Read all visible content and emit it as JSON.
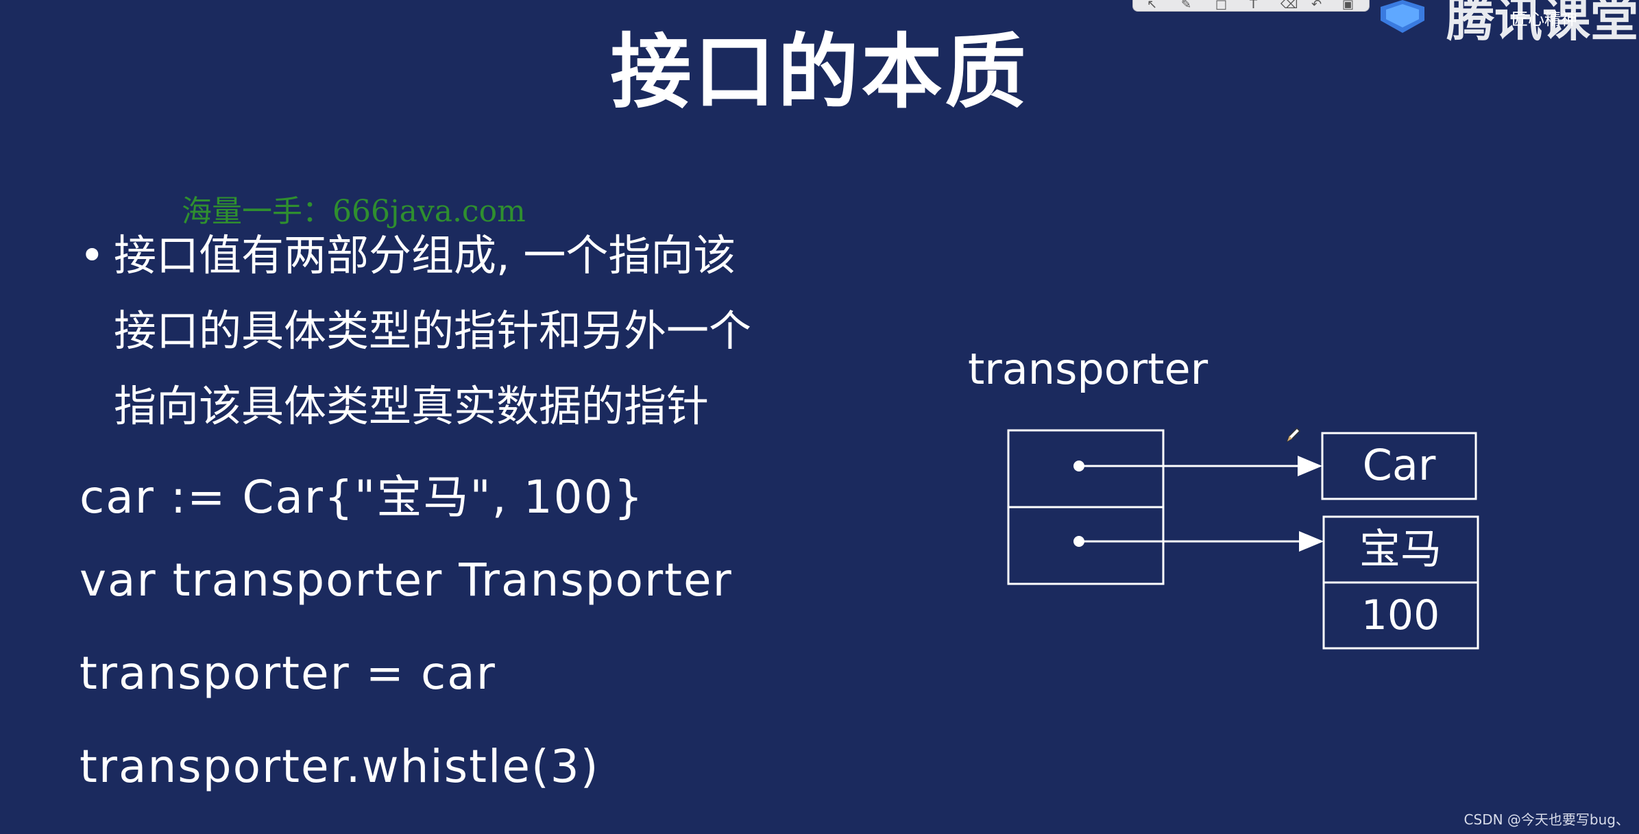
{
  "slide": {
    "title": "接口的本质",
    "watermark": "海量一手：666java.com",
    "bullet_marker": "•",
    "bullet_lines": [
      "接口值有两部分组成, 一个指向该",
      "接口的具体类型的指针和另外一个",
      "指向该具体类型真实数据的指针"
    ],
    "code_lines": [
      "car := Car{\"宝马\", 100}",
      "var transporter Transporter",
      "transporter = car",
      "transporter.whistle(3)"
    ]
  },
  "diagram": {
    "variable_label": "transporter",
    "type_box_label": "Car",
    "data_fields": [
      "宝马",
      "100"
    ]
  },
  "player": {
    "brand_text": "腾讯课堂",
    "brand_subtext": "匠心精神",
    "toolbar_icons": [
      "select-icon",
      "pen-icon",
      "shape-icon",
      "text-icon",
      "eraser-icon",
      "undo-icon",
      "clear-icon"
    ]
  },
  "footer": {
    "credit": "CSDN @今天也要写bug、"
  },
  "colors": {
    "background": "#1b2a5e",
    "text": "#ffffff",
    "watermark": "#2f8f2f"
  }
}
